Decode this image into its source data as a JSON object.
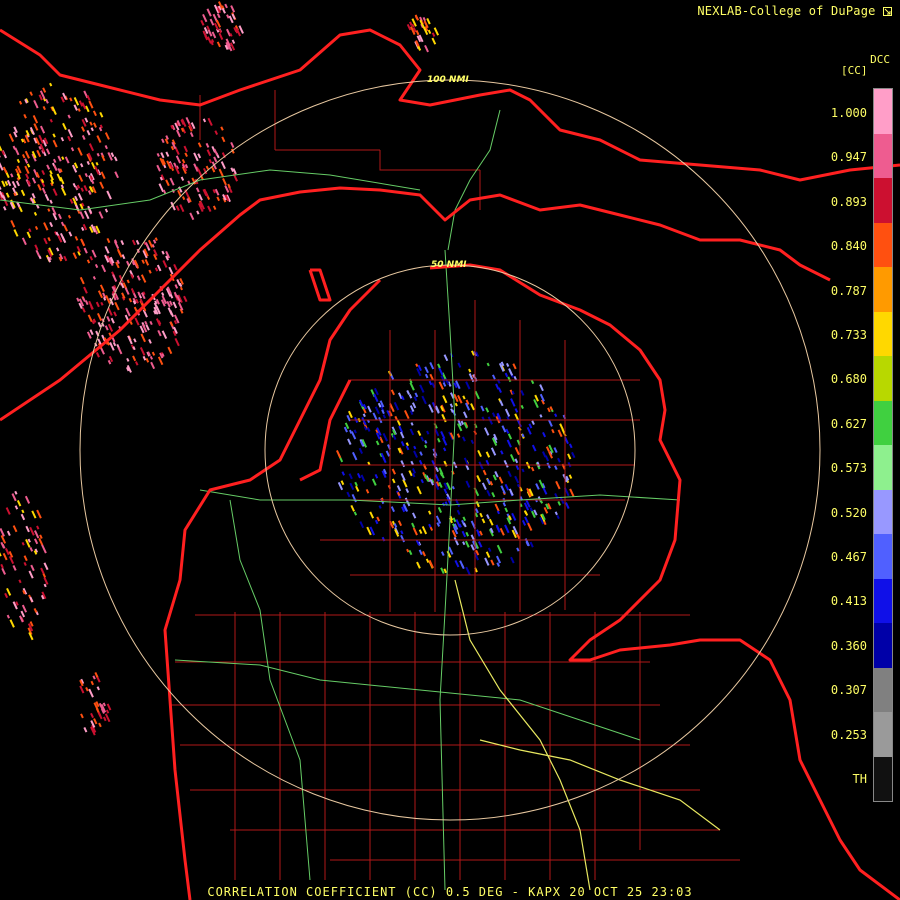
{
  "header": {
    "credit": "NEXLAB-College of DuPage",
    "credit_icon": "corner-arrow-icon",
    "product_code": "DCC",
    "unit": "[CC]"
  },
  "map": {
    "range_rings": [
      {
        "label": "100 NMI"
      },
      {
        "label": "50 NMI"
      }
    ],
    "colors": {
      "state_border": "#ff2020",
      "county_border": "#b01818",
      "highway": "#66cc66",
      "interstate": "#e8e860",
      "range_ring": "#e8c8a0"
    }
  },
  "legend": {
    "labels": [
      "1.000",
      "0.947",
      "0.893",
      "0.840",
      "0.787",
      "0.733",
      "0.680",
      "0.627",
      "0.573",
      "0.520",
      "0.467",
      "0.413",
      "0.360",
      "0.307",
      "0.253",
      "TH"
    ],
    "colors": [
      "#ff9ec8",
      "#ee5c90",
      "#cc1030",
      "#ff5010",
      "#ff9a00",
      "#ffd800",
      "#b8d800",
      "#40d040",
      "#8ef08e",
      "#9898ff",
      "#5060ff",
      "#1010e8",
      "#0000a8",
      "#808080",
      "#9a9a9a",
      "#111111"
    ]
  },
  "footer": {
    "caption": "CORRELATION COEFFICIENT (CC) 0.5 DEG - KAPX 20 OCT 25 23:03"
  }
}
